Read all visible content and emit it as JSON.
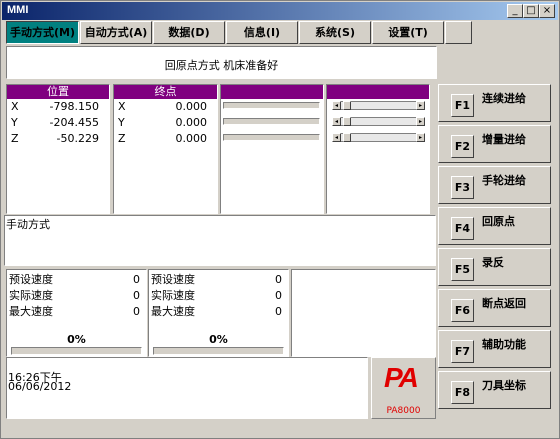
{
  "window": {
    "title": "MMI"
  },
  "caption_buttons": [
    "_",
    "□",
    "×"
  ],
  "tabs": [
    {
      "label": "手动方式(M)"
    },
    {
      "label": "自动方式(A)"
    },
    {
      "label": "数据(D)"
    },
    {
      "label": "信息(I)"
    },
    {
      "label": "系统(S)"
    },
    {
      "label": "设置(T)"
    },
    {
      "label": ""
    }
  ],
  "status": {
    "text": "回原点方式 机床准备好"
  },
  "position_panel": {
    "title": "位置",
    "rows": [
      {
        "axis": "X",
        "value": "-798.150"
      },
      {
        "axis": "Y",
        "value": "-204.455"
      },
      {
        "axis": "Z",
        "value": "-50.229"
      }
    ]
  },
  "endpoint_panel": {
    "title": "终点",
    "rows": [
      {
        "axis": "X",
        "value": "0.000"
      },
      {
        "axis": "Y",
        "value": "0.000"
      },
      {
        "axis": "Z",
        "value": "0.000"
      }
    ]
  },
  "mode_text": "手动方式",
  "speed_panels": [
    {
      "rows": [
        {
          "label": "预设速度",
          "value": "0"
        },
        {
          "label": "实际速度",
          "value": "0"
        },
        {
          "label": "最大速度",
          "value": "0"
        }
      ],
      "percent": "0%"
    },
    {
      "rows": [
        {
          "label": "预设速度",
          "value": "0"
        },
        {
          "label": "实际速度",
          "value": "0"
        },
        {
          "label": "最大速度",
          "value": "0"
        }
      ],
      "percent": "0%"
    }
  ],
  "clock": {
    "time": "16:26下午",
    "date": "06/06/2012"
  },
  "logo": {
    "mark": "PA",
    "model": "PA8000",
    "color": "#e00000"
  },
  "function_buttons": [
    {
      "key": "F1",
      "label": "连续进给"
    },
    {
      "key": "F2",
      "label": "增量进给"
    },
    {
      "key": "F3",
      "label": "手轮进给"
    },
    {
      "key": "F4",
      "label": "回原点"
    },
    {
      "key": "F5",
      "label": "录反"
    },
    {
      "key": "F6",
      "label": "断点返回"
    },
    {
      "key": "F7",
      "label": "辅助功能"
    },
    {
      "key": "F8",
      "label": "刀具坐标"
    }
  ],
  "colors": {
    "title_bar": "#0a246a",
    "panel_header": "#800080",
    "active_tab": "#008080"
  }
}
